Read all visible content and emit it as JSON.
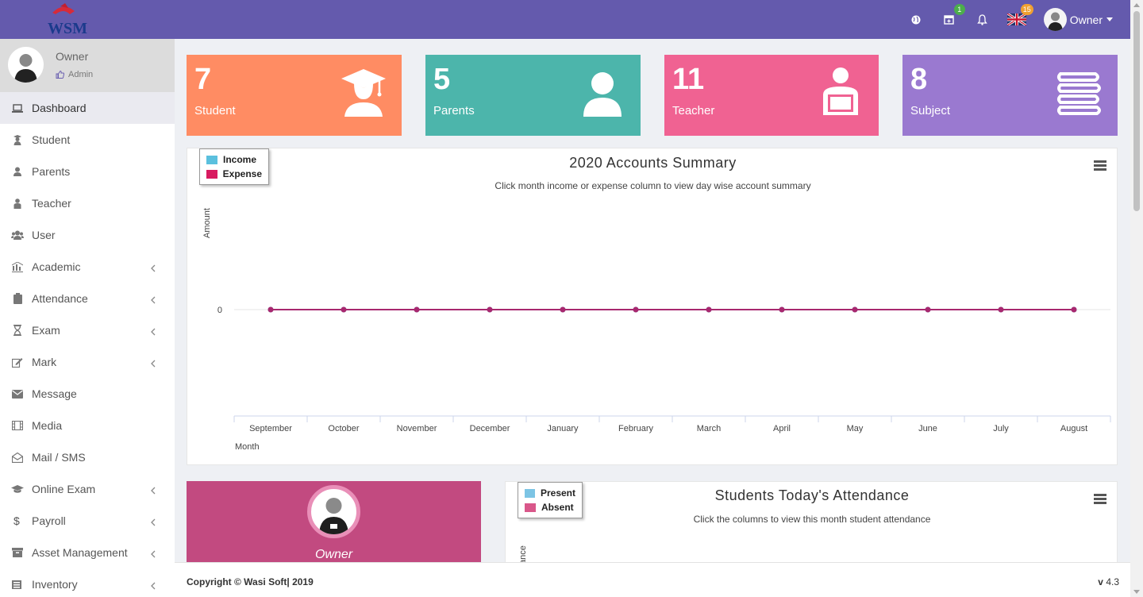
{
  "header": {
    "logo_text": "WSMS",
    "calendar_badge": "1",
    "language_badge": "15",
    "user_name": "Owner"
  },
  "sidebar": {
    "user_name": "Owner",
    "user_role": "Admin",
    "items": [
      {
        "label": "Dashboard",
        "icon": "laptop-icon",
        "has_submenu": false,
        "active": true
      },
      {
        "label": "Student",
        "icon": "student-icon",
        "has_submenu": false
      },
      {
        "label": "Parents",
        "icon": "user-icon",
        "has_submenu": false
      },
      {
        "label": "Teacher",
        "icon": "teacher-icon",
        "has_submenu": false
      },
      {
        "label": "User",
        "icon": "users-icon",
        "has_submenu": false
      },
      {
        "label": "Academic",
        "icon": "institution-icon",
        "has_submenu": true
      },
      {
        "label": "Attendance",
        "icon": "clipboard-icon",
        "has_submenu": true
      },
      {
        "label": "Exam",
        "icon": "hourglass-icon",
        "has_submenu": true
      },
      {
        "label": "Mark",
        "icon": "edit-icon",
        "has_submenu": true
      },
      {
        "label": "Message",
        "icon": "envelope-icon",
        "has_submenu": false
      },
      {
        "label": "Media",
        "icon": "film-icon",
        "has_submenu": false
      },
      {
        "label": "Mail / SMS",
        "icon": "open-envelope-icon",
        "has_submenu": false
      },
      {
        "label": "Online Exam",
        "icon": "graduation-cap-icon",
        "has_submenu": true
      },
      {
        "label": "Payroll",
        "icon": "dollar-icon",
        "has_submenu": true
      },
      {
        "label": "Asset Management",
        "icon": "archive-icon",
        "has_submenu": true
      },
      {
        "label": "Inventory",
        "icon": "inventory-icon",
        "has_submenu": true
      }
    ]
  },
  "stats": [
    {
      "count": "7",
      "label": "Student",
      "color": "#ff8c63",
      "icon": "graduate-icon"
    },
    {
      "count": "5",
      "label": "Parents",
      "color": "#4cb5ab",
      "icon": "person-icon"
    },
    {
      "count": "11",
      "label": "Teacher",
      "color": "#f06292",
      "icon": "teacher-laptop-icon"
    },
    {
      "count": "8",
      "label": "Subject",
      "color": "#9a79d0",
      "icon": "books-icon"
    }
  ],
  "accounts_chart": {
    "title": "2020 Accounts Summary",
    "subtitle": "Click month income or expense column to view day wise account summary",
    "legend": [
      "Income",
      "Expense"
    ]
  },
  "chart_data": {
    "type": "line",
    "categories": [
      "September",
      "October",
      "November",
      "December",
      "January",
      "February",
      "March",
      "April",
      "May",
      "June",
      "July",
      "August"
    ],
    "series": [
      {
        "name": "Income",
        "values": [
          0,
          0,
          0,
          0,
          0,
          0,
          0,
          0,
          0,
          0,
          0,
          0
        ],
        "color": "#5bc0de"
      },
      {
        "name": "Expense",
        "values": [
          0,
          0,
          0,
          0,
          0,
          0,
          0,
          0,
          0,
          0,
          0,
          0
        ],
        "color": "#a8286f"
      }
    ],
    "title": "2020 Accounts Summary",
    "xlabel": "Month",
    "ylabel": "Amount",
    "yticks": [
      "0"
    ],
    "legend_position": "top-left"
  },
  "profile": {
    "name": "Owner"
  },
  "attendance_chart": {
    "title": "Students Today's Attendance",
    "subtitle": "Click the columns to view this month student attendance",
    "legend": [
      "Present",
      "Absent"
    ],
    "ylabel_visible": "ance"
  },
  "footer": {
    "copyright": "Copyright © Wasi Soft| 2019",
    "version_prefix": "v",
    "version": "4.3"
  },
  "colors": {
    "topbar": "#645aad",
    "income": "#5bc0de",
    "expense": "#d81b60",
    "present": "#7cc4e4",
    "absent": "#d9578a",
    "profile_card": "#c24a80"
  }
}
